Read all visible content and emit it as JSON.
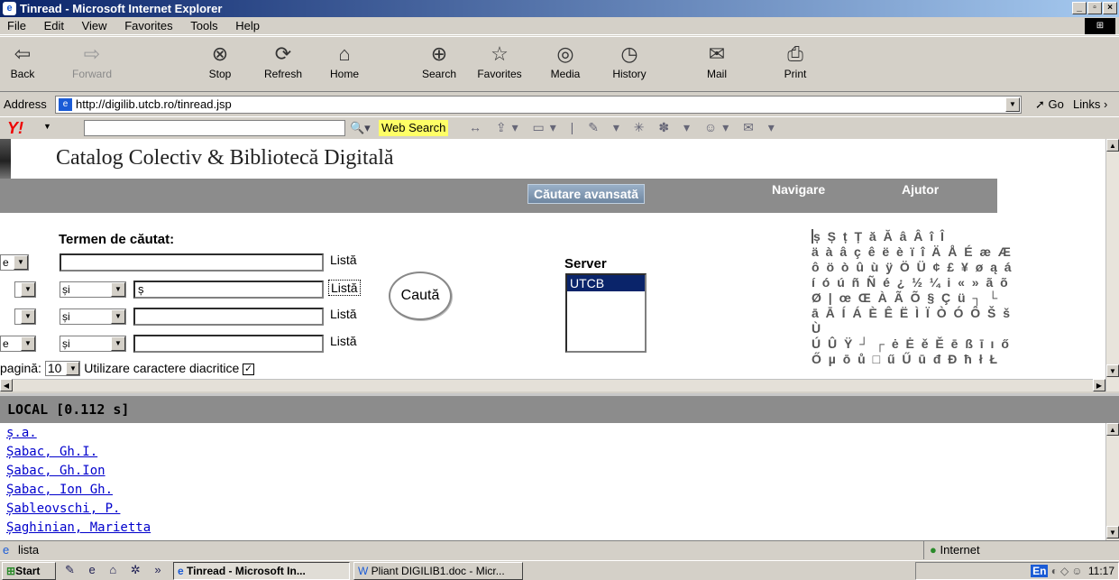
{
  "window": {
    "title": "Tinread - Microsoft Internet Explorer"
  },
  "menu": [
    "File",
    "Edit",
    "View",
    "Favorites",
    "Tools",
    "Help"
  ],
  "toolbar": {
    "back": "Back",
    "forward": "Forward",
    "stop": "Stop",
    "refresh": "Refresh",
    "home": "Home",
    "search": "Search",
    "favorites": "Favorites",
    "media": "Media",
    "history": "History",
    "mail": "Mail",
    "print": "Print"
  },
  "address": {
    "label": "Address",
    "url": "http://digilib.utcb.ro/tinread.jsp",
    "go": "Go",
    "links": "Links"
  },
  "yahoo": {
    "web_search": "Web Search"
  },
  "page": {
    "title": "Catalog Colectiv & Bibliotecă Digitală",
    "nav": {
      "advanced": "Căutare avansată",
      "browse": "Navigare",
      "help": "Ajutor"
    },
    "search_term_label": "Termen de căutat:",
    "rows": [
      {
        "field": "e",
        "op": "",
        "value": "",
        "list": "Listă"
      },
      {
        "field": "",
        "op": "și",
        "value": "ș",
        "list": "Listă"
      },
      {
        "field": "",
        "op": "și",
        "value": "",
        "list": "Listă"
      },
      {
        "field": "e",
        "op": "și",
        "value": "",
        "list": "Listă"
      }
    ],
    "search_button": "Caută",
    "server_label": "Server",
    "server_option": "UTCB",
    "per_page_label": "pagină:",
    "per_page_value": "10",
    "diacritics_label": "Utilizare caractere diacritice",
    "diacritics": [
      "ș Ș ț Ț ă Ă â Â î Î",
      "ä à â ç ê ë è ï î Ä Å É æ Æ",
      "ô ö ò û ù ÿ Ö Ü ¢ £ ¥ ø ą á",
      "í ó ú ñ Ñ é ¿ ½ ¼ i « » ã õ",
      "Ø | œ Œ À Ã Õ § Ç ü ┐ └",
      "ā Ā Í Á È Ê Ë Ì Ï Ò Ó Ô Š š",
      "Ù",
      "Ú Û Ÿ ┘ ┌ ė Ė ě Ě ē ß ī ı ő",
      "Ő µ ō ů □ ű Ű ū đ Đ ħ ł Ł"
    ]
  },
  "local": {
    "header": "LOCAL [0.112 s]",
    "results": [
      "ș.a.",
      "Șabac, Gh.I.",
      "Șabac, Gh.Ion",
      "Șabac, Ion Gh.",
      "Șableovschi, P.",
      "Șaghinian, Marietta"
    ]
  },
  "status": {
    "text": "lista",
    "zone": "Internet"
  },
  "taskbar": {
    "start": "Start",
    "tasks": [
      "Tinread - Microsoft In...",
      "Pliant DIGILIB1.doc - Micr..."
    ],
    "lang": "En",
    "clock": "11:17"
  }
}
